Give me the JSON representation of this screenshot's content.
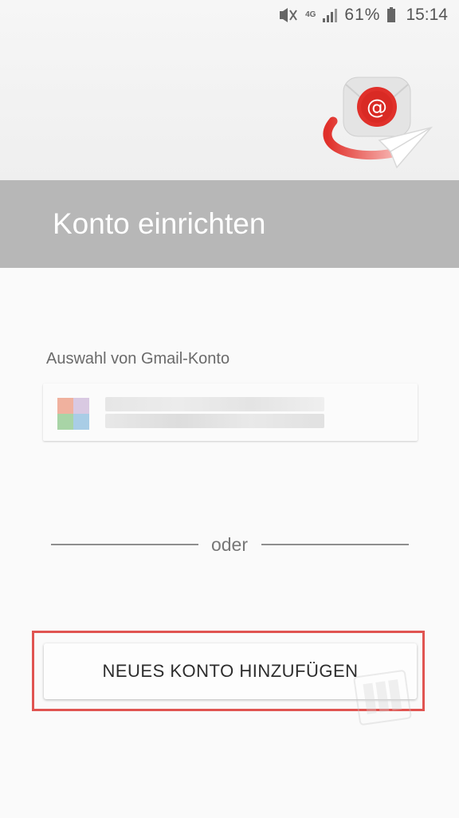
{
  "statusbar": {
    "network": "4G",
    "battery_percent": "61%",
    "time": "15:14",
    "icons": [
      "mute-icon",
      "signal-icon",
      "battery-icon"
    ]
  },
  "header": {
    "title": "Konto einrichten",
    "graphic": "email-send-icon",
    "accent_color": "#e0302a"
  },
  "accounts": {
    "section_label": "Auswahl von Gmail-Konto"
  },
  "divider": {
    "text": "oder"
  },
  "actions": {
    "add_account_label": "NEUES KONTO HINZUFÜGEN"
  },
  "colors": {
    "title_bar": "#b7b7b7",
    "highlight": "#e05451",
    "background": "#fafafa"
  }
}
